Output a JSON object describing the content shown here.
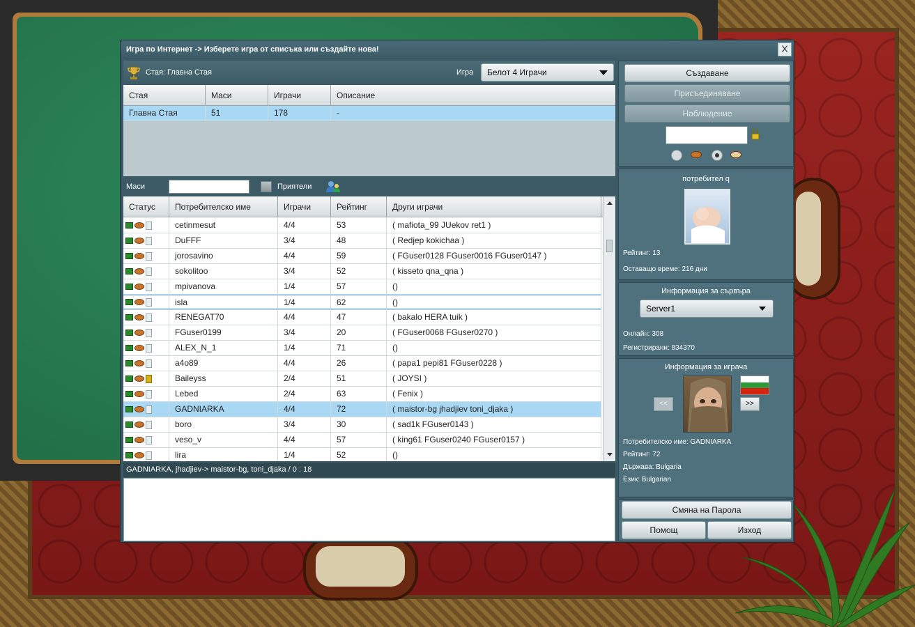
{
  "window": {
    "title": "Игра по Интернет   ->  Изберете игра от списъка или създайте нова!",
    "close_label": "X"
  },
  "room_bar": {
    "room_label": "Стая: Главна Стая",
    "game_label": "Игра",
    "game_selected": "Белот 4 Играчи"
  },
  "rooms_table": {
    "headers": [
      "Стая",
      "Маси",
      "Играчи",
      "Описание"
    ],
    "rows": [
      [
        "Главна Стая",
        "51",
        "178",
        "-"
      ]
    ]
  },
  "filter": {
    "tables_label": "Маси",
    "friends_label": "Приятели"
  },
  "players_table": {
    "headers": [
      "Статус",
      "Потребителско име",
      "Играчи",
      "Рейтинг",
      "Други играчи"
    ],
    "rows": [
      {
        "name": "cetinmesut",
        "players": "4/4",
        "rating": "53",
        "others": "( mafiota_99  JUekov  ret1 )",
        "lock": "white"
      },
      {
        "name": "DuFFF",
        "players": "3/4",
        "rating": "48",
        "others": "( Redjep  kokichaa )",
        "lock": "white"
      },
      {
        "name": "jorosavino",
        "players": "4/4",
        "rating": "59",
        "others": "( FGuser0128  FGuser0016  FGuser0147 )",
        "lock": "white"
      },
      {
        "name": "sokolitoo",
        "players": "3/4",
        "rating": "52",
        "others": "( kisseto  qna_qna )",
        "lock": "white"
      },
      {
        "name": "mpivanova",
        "players": "1/4",
        "rating": "57",
        "others": "()",
        "lock": "white"
      },
      {
        "name": "isla",
        "players": "1/4",
        "rating": "62",
        "others": "()",
        "lock": "white"
      },
      {
        "name": "RENEGAT70",
        "players": "4/4",
        "rating": "47",
        "others": "( bakalo  HERA  tuik )",
        "lock": "white"
      },
      {
        "name": "FGuser0199",
        "players": "3/4",
        "rating": "20",
        "others": "( FGuser0068  FGuser0270 )",
        "lock": "white"
      },
      {
        "name": "ALEX_N_1",
        "players": "1/4",
        "rating": "71",
        "others": "()",
        "lock": "white"
      },
      {
        "name": "a4o89",
        "players": "4/4",
        "rating": "26",
        "others": "( papa1  pepi81  FGuser0228 )",
        "lock": "white"
      },
      {
        "name": "Baileyss",
        "players": "2/4",
        "rating": "51",
        "others": "( JOYSI )",
        "lock": "gold"
      },
      {
        "name": "Lebed",
        "players": "2/4",
        "rating": "63",
        "others": "( Fenix )",
        "lock": "white"
      },
      {
        "name": "GADNIARKA",
        "players": "4/4",
        "rating": "72",
        "others": "( maistor-bg  jhadjiev  toni_djaka )",
        "lock": "white"
      },
      {
        "name": "boro",
        "players": "3/4",
        "rating": "30",
        "others": "( sad1k  FGuser0143 )",
        "lock": "white"
      },
      {
        "name": "veso_v",
        "players": "4/4",
        "rating": "57",
        "others": "( king61  FGuser0240  FGuser0157 )",
        "lock": "white"
      },
      {
        "name": "lira",
        "players": "1/4",
        "rating": "52",
        "others": "()",
        "lock": "white"
      }
    ],
    "selected_row": "GADNIARKA",
    "focused_row": "isla"
  },
  "status_line": "GADNIARKA, jhadjiev-> maistor-bg, toni_djaka / 0 : 18",
  "actions": {
    "create": "Създаване",
    "join": "Присъединяване",
    "watch": "Наблюдение"
  },
  "user_panel": {
    "username": "потребител q",
    "rating": "Рейтинг: 13",
    "time_left": "Оставащо време: 216 дни"
  },
  "server_panel": {
    "title": "Информация за сървъра",
    "server": "Server1",
    "online": "Онлайн: 308",
    "registered": "Регистрирани: 834370"
  },
  "player_panel": {
    "title": "Информация за играча",
    "prev": "<<",
    "next": ">>",
    "username": "Потребителско име: GADNIARKA",
    "rating": "Рейтинг: 72",
    "country": "Държава: Bulgaria",
    "language": "Език: Bulgarian"
  },
  "bottom_buttons": {
    "change_password": "Смяна на Парола",
    "help": "Помощ",
    "exit": "Изход"
  },
  "colors": {
    "dialog_bg": "#3c5a66",
    "selected_row": "#a9d8f5",
    "flag": [
      "#ffffff",
      "#2e9b3a",
      "#d62612"
    ]
  }
}
